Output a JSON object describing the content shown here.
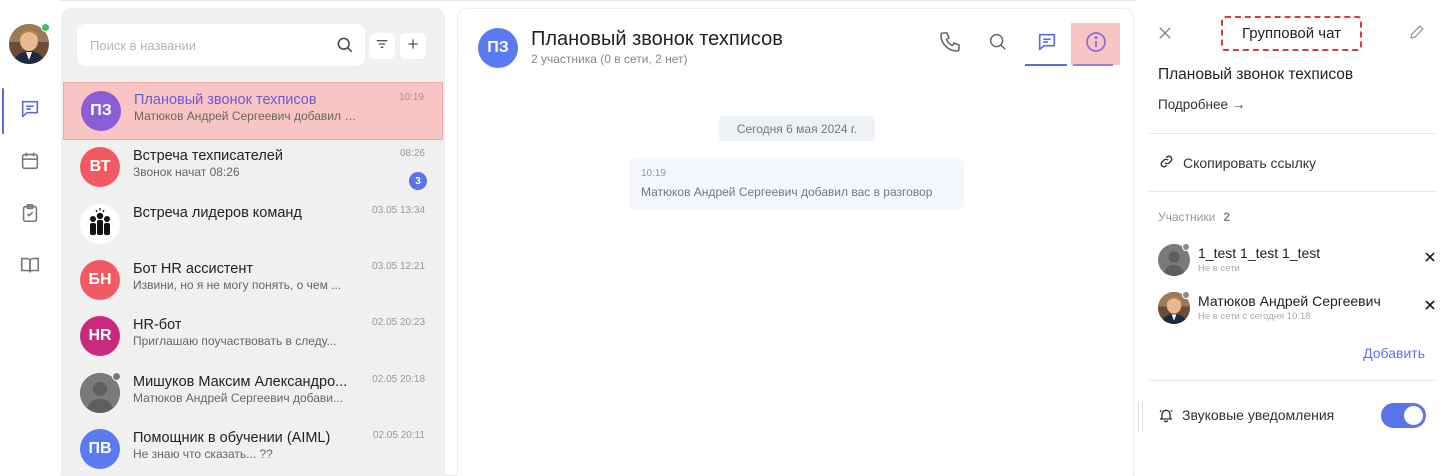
{
  "search": {
    "placeholder": "Поиск в названии"
  },
  "chats": [
    {
      "initials": "ПЗ",
      "name": "Плановый звонок техписов",
      "preview": "Матюков Андрей Сергеевич добавил вас...",
      "time": "10:19",
      "color": "#8a5cd6",
      "selected": true
    },
    {
      "initials": "ВТ",
      "name": "Встреча техписателей",
      "preview": "Звонок начат 08:26",
      "time": "08:26",
      "color": "#f25a63",
      "unread": "3"
    },
    {
      "initials": "",
      "name": "Встреча лидеров команд",
      "preview": "",
      "time": "03.05 13:34",
      "icon": "team-leaders-icon"
    },
    {
      "initials": "БН",
      "name": "Бот HR ассистент",
      "preview": "Извини, но я не могу понять, о чем ...",
      "time": "03.05 12:21",
      "color": "#f25a63"
    },
    {
      "initials": "HR",
      "name": "HR-бот",
      "preview": "Приглашаю поучаствовать в следу...",
      "time": "02.05 20:23",
      "color": "#c72a7e"
    },
    {
      "initials": "",
      "name": "Мишуков Максим Александро...",
      "preview": "Матюков Андрей Сергеевич добави...",
      "time": "02.05 20:18",
      "icon": "person-placeholder-icon",
      "status": "offline"
    },
    {
      "initials": "ПВ",
      "name": "Помощник в обучении (AIML)",
      "preview": "Не знаю что сказать... ??",
      "time": "02.05 20:11",
      "color": "#5a7bf0"
    }
  ],
  "conversation": {
    "initials": "ПЗ",
    "title": "Плановый звонок техписов",
    "subtitle": "2 участника (0 в сети, 2 нет)",
    "date": "Сегодня 6 мая 2024 г.",
    "system_message": {
      "time": "10:19",
      "text": "Матюков Андрей Сергеевич добавил вас в разговор"
    }
  },
  "info": {
    "header_label": "Групповой чат",
    "title": "Плановый звонок техписов",
    "details": "Подробнее →",
    "copy_link": "Скопировать ссылку",
    "participants_label": "Участники",
    "participants_count": "2",
    "members": [
      {
        "name": "1_test 1_test 1_test",
        "status": "Не в сети",
        "avatar": "person-placeholder-icon"
      },
      {
        "name": "Матюков Андрей Сергеевич",
        "status": "Не в сети с сегодня 10:18",
        "avatar": "user-photo"
      }
    ],
    "add": "Добавить",
    "notifications_label": "Звуковые уведомления",
    "notifications_on": true
  },
  "colors": {
    "accent": "#5a73e8",
    "selected_bg": "#f8c4c4",
    "online": "#3ec25a"
  }
}
